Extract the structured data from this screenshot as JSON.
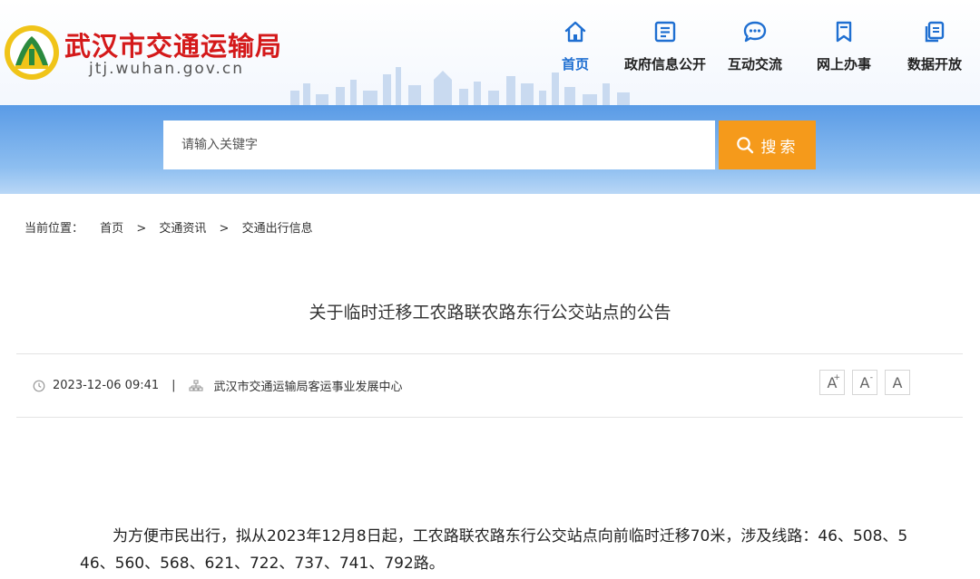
{
  "header": {
    "site_title": "武汉市交通运输局",
    "domain": "jtj.wuhan.gov.cn",
    "nav": [
      {
        "label": "首页",
        "icon": "home-icon"
      },
      {
        "label": "政府信息公开",
        "icon": "document-list-icon"
      },
      {
        "label": "互动交流",
        "icon": "chat-bubble-icon"
      },
      {
        "label": "网上办事",
        "icon": "bookmark-icon"
      },
      {
        "label": "数据开放",
        "icon": "data-copy-icon"
      }
    ]
  },
  "search": {
    "placeholder": "请输入关键字",
    "button_label": "搜索"
  },
  "breadcrumb": {
    "prefix": "当前位置：",
    "items": [
      "首页",
      "交通资讯",
      "交通出行信息"
    ],
    "separator": ">"
  },
  "article": {
    "title": "关于临时迁移工农路联农路东行公交站点的公告",
    "date": "2023-12-06 09:41",
    "meta_separator": "|",
    "source": "武汉市交通运输局客运事业发展中心",
    "font_tools": [
      "A+",
      "A-",
      "A"
    ],
    "body": "为方便市民出行，拟从2023年12月8日起，工农路联农路东行公交站点向前临时迁移70米，涉及线路：46、508、546、560、568、621、722、737、741、792路。"
  },
  "colors": {
    "brand_red": "#d4191a",
    "nav_active": "#1f6fd1",
    "search_button": "#f59a1b",
    "band_blue": "#5a9be6"
  }
}
